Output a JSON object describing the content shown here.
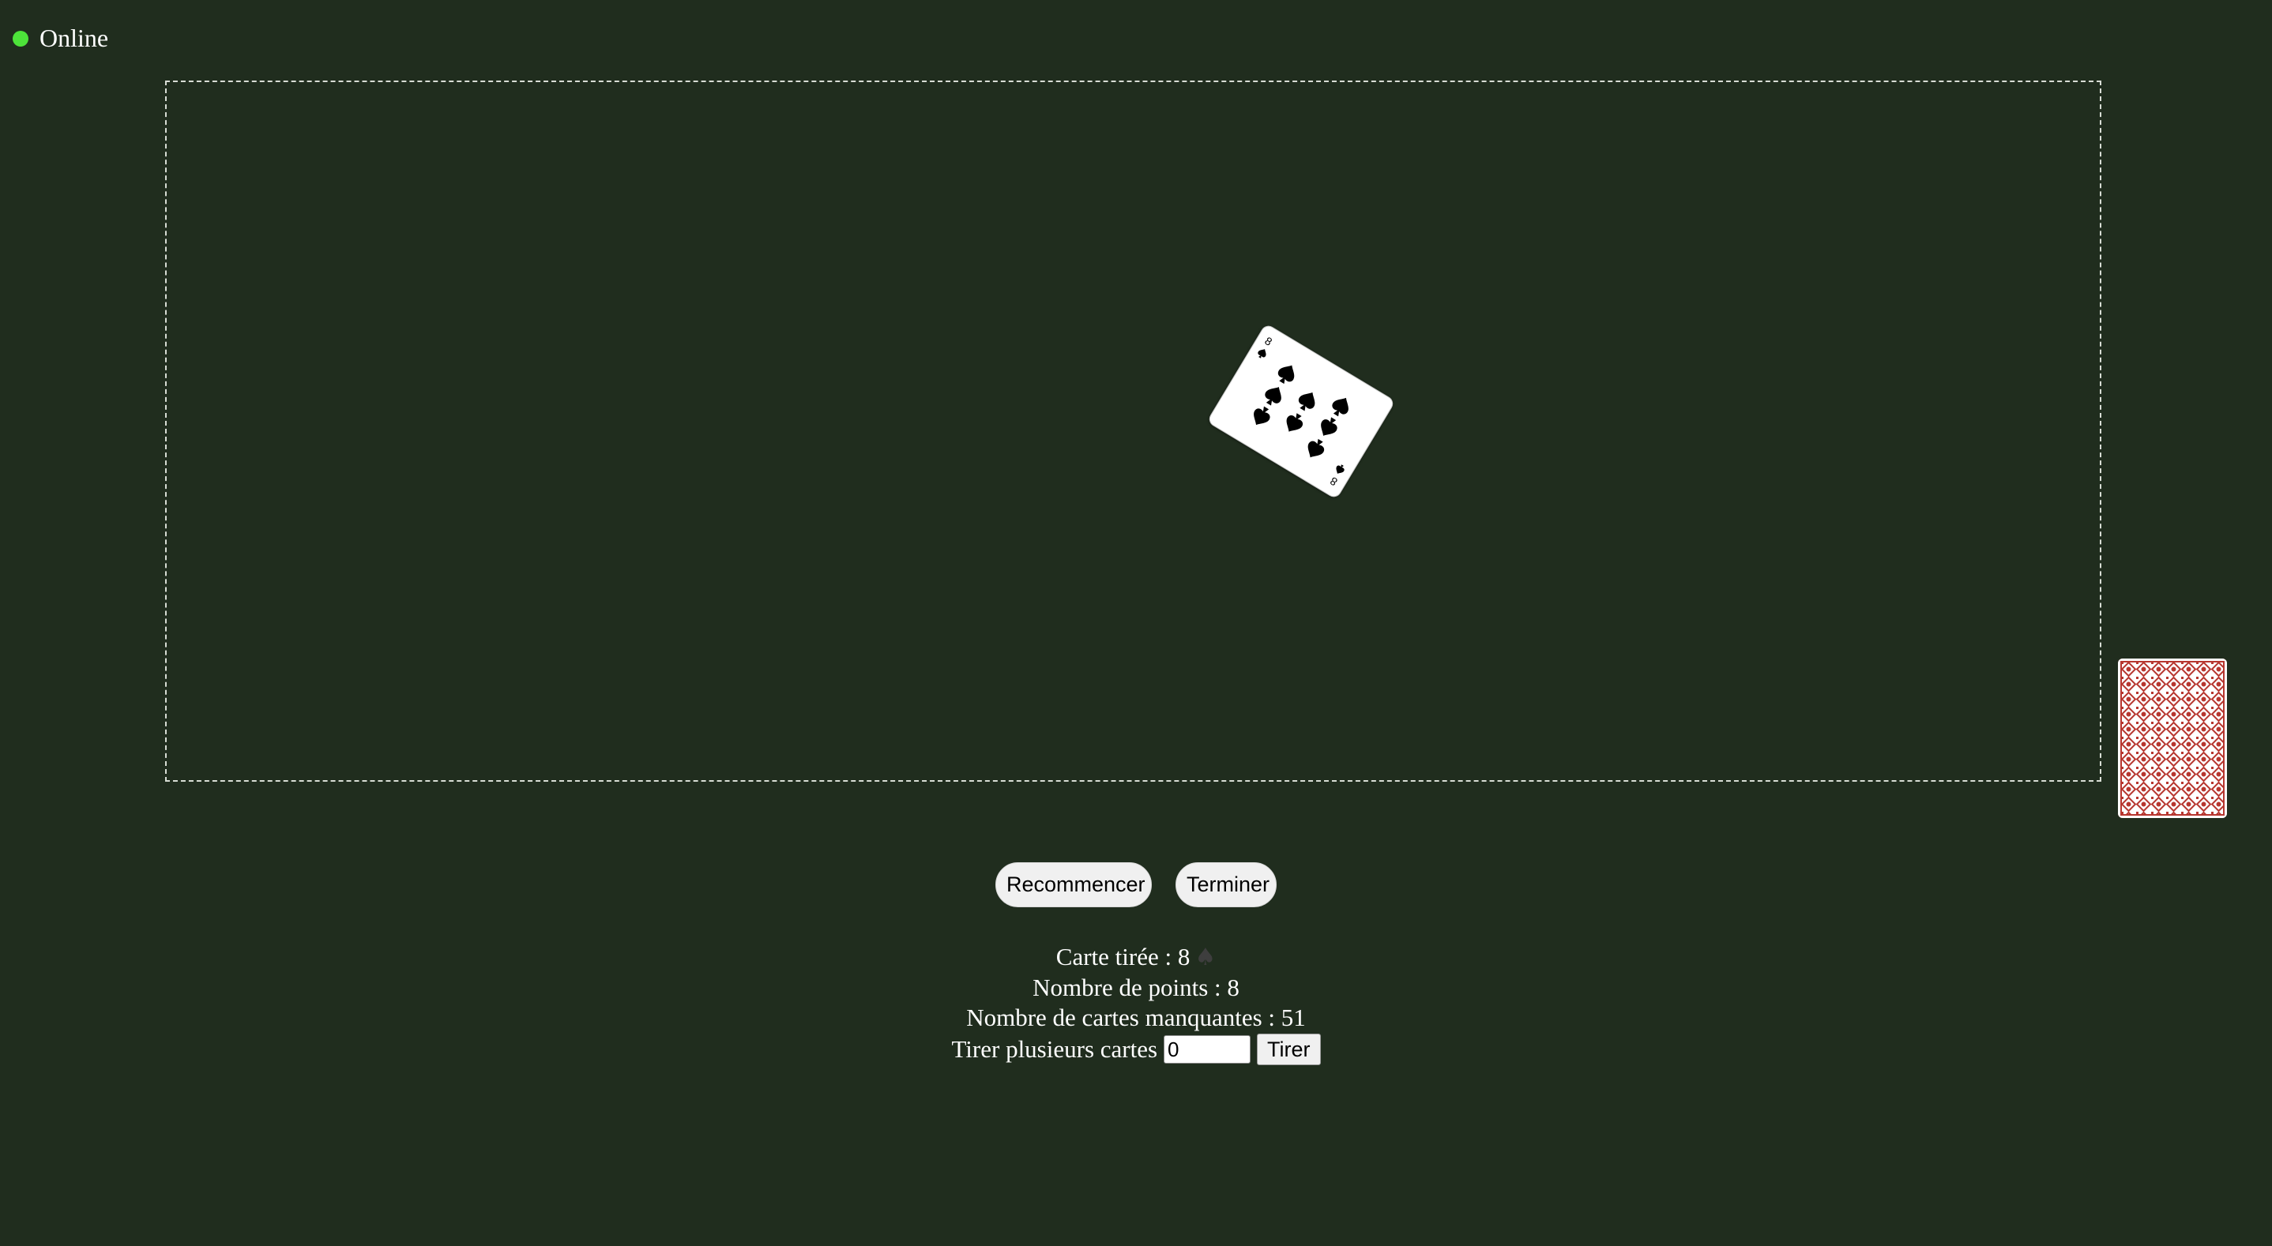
{
  "status": {
    "label": "Online",
    "color": "#4de33a"
  },
  "table": {
    "drawn_card": {
      "rank": "8",
      "suit": "spades",
      "suit_symbol": "♠"
    },
    "deck": {
      "back_color": "#b7362f",
      "icon": "card-back-icon"
    }
  },
  "controls": {
    "restart_label": "Recommencer",
    "end_label": "Terminer"
  },
  "info": {
    "drawn_card_label": "Carte tirée : 8",
    "drawn_card_suit_icon": "♠",
    "points_label": "Nombre de points : 8",
    "missing_cards_label": "Nombre de cartes manquantes : 51",
    "draw_multiple_label": "Tirer plusieurs cartes",
    "draw_multiple_value": "0",
    "draw_button_label": "Tirer"
  },
  "colors": {
    "background": "#202d1e",
    "table_border": "#d8ddd5",
    "card_back": "#b7362f"
  }
}
